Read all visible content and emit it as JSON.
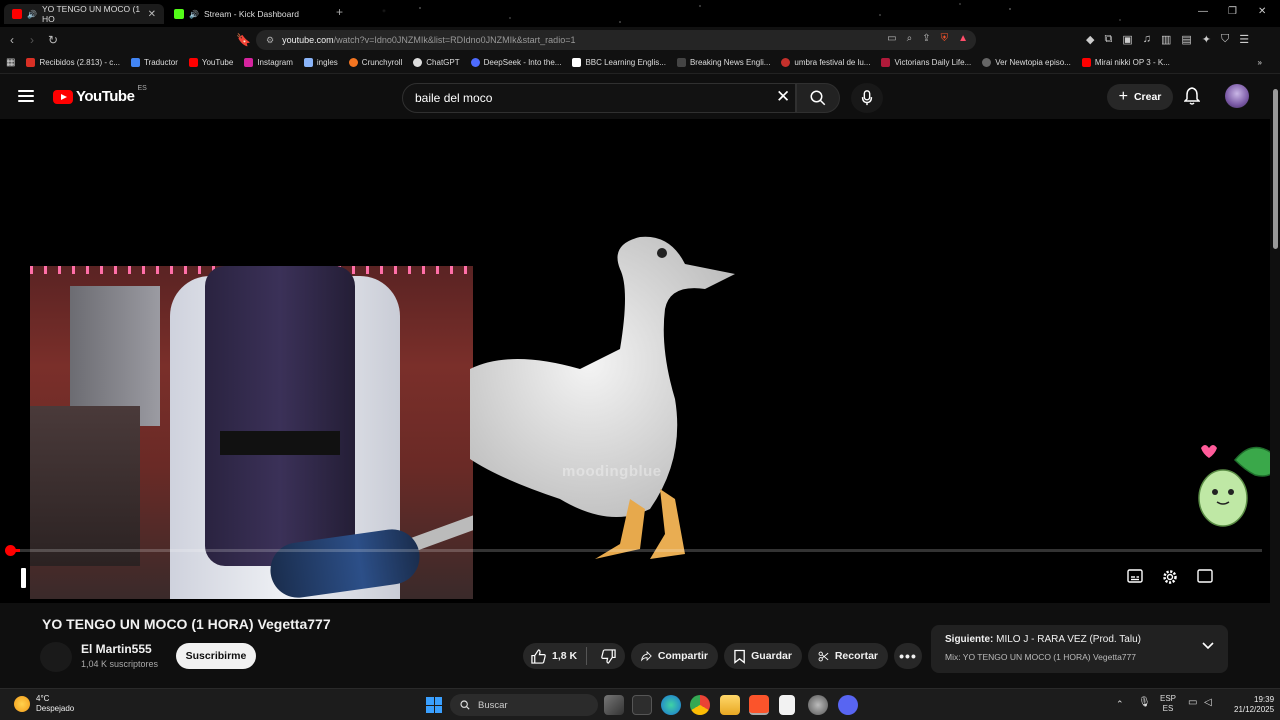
{
  "browser": {
    "tabs": [
      {
        "title": "YO TENGO UN MOCO (1 HO",
        "active": true
      },
      {
        "title": "Stream - Kick Dashboard",
        "active": false
      }
    ],
    "url_main": "youtube.com",
    "url_rest": "/watch?v=Idno0JNZMIk&list=RDIdno0JNZMIk&start_radio=1",
    "bookmarks": [
      "Recibidos (2.813) - c...",
      "Traductor",
      "YouTube",
      "Instagram",
      "ingles",
      "Crunchyroll",
      "ChatGPT",
      "DeepSeek - Into the...",
      "BBC Learning Englis...",
      "Breaking News Engli...",
      "umbra festival de lu...",
      "Victorians Daily Life...",
      "Ver Newtopia episo...",
      "Mirai nikki OP 3 - K..."
    ]
  },
  "youtube": {
    "logo_text": "YouTube",
    "region": "ES",
    "search_value": "baile del moco",
    "create_label": "Crear"
  },
  "player": {
    "watermark": "moodingblue",
    "progress_fraction": 0.006
  },
  "video": {
    "title": "YO TENGO UN MOCO (1 HORA) Vegetta777",
    "channel": "El Martin555",
    "subscribers": "1,04 K suscriptores",
    "subscribe_label": "Suscribirme",
    "likes": "1,8 K",
    "share_label": "Compartir",
    "save_label": "Guardar",
    "clip_label": "Recortar"
  },
  "up_next": {
    "label": "Siguiente:",
    "title": "MILO J - RARA VEZ (Prod. Talu)",
    "mix": "Mix: YO TENGO UN MOCO (1 HORA) Vegetta777"
  },
  "taskbar": {
    "temp": "4°C",
    "weather": "Despejado",
    "search_label": "Buscar",
    "lang1": "ESP",
    "lang2": "ES",
    "time": "19:39",
    "date": "21/12/2025"
  },
  "colors": {
    "accent": "#ff0000",
    "background": "#0f0f0f",
    "pill": "#272727"
  }
}
